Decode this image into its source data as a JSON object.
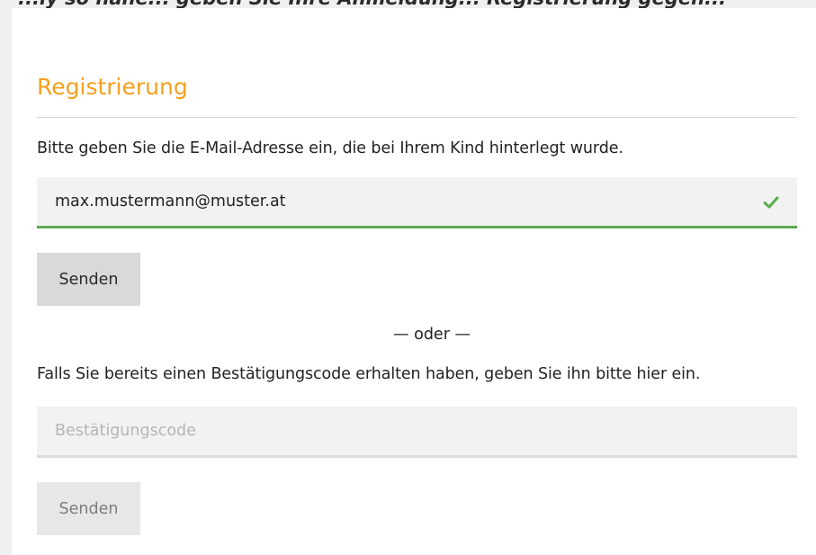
{
  "header": {
    "clipped_text": "...ly so nahe...  geben Sie Ihre Anmeldung... Registrierung gegen..."
  },
  "form": {
    "title": "Registrierung",
    "email_instruction": "Bitte geben Sie die E-Mail-Adresse ein, die bei Ihrem Kind hinterlegt wurde.",
    "email_value": "max.mustermann@muster.at",
    "email_valid_icon": "check-icon",
    "email_submit_label": "Senden",
    "divider_text": "— oder —",
    "code_instruction": "Falls Sie bereits einen Bestätigungscode erhalten haben, geben Sie ihn bitte hier ein.",
    "code_value": "",
    "code_placeholder": "Bestätigungscode",
    "code_submit_label": "Senden"
  },
  "colors": {
    "title": "#f5a01d",
    "valid_border": "#5aab4e",
    "check_icon": "#5aab4e",
    "field_background": "#f2f2f2"
  }
}
